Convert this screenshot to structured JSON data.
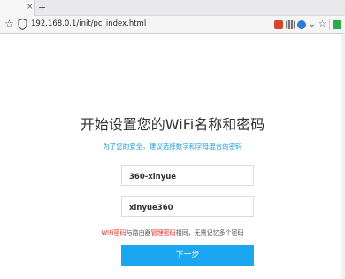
{
  "browser": {
    "tab_close": "×",
    "new_tab": "+",
    "url": "192.168.0.1/init/pc_index.html",
    "icons": [
      "star-icon",
      "shield-icon",
      "lock-shield-icon",
      "grid-icon",
      "blue-circle-icon",
      "chevron-down-icon",
      "star-icon",
      "green-square-icon"
    ]
  },
  "page": {
    "heading": "开始设置您的WiFi名称和密码",
    "subtitle": "为了您的安全，建议选择数字和字母混合的密码",
    "wifi_name": "360-xinyue",
    "wifi_password": "xinyue360",
    "note_part1": "WiFi密码",
    "note_part2": "与路由器",
    "note_part3": "管理密码",
    "note_part4": "相同，无需记忆多个密码",
    "next_label": "下一步"
  },
  "colors": {
    "accent": "#1ba6f1",
    "subtitle": "#1a9fe0",
    "warning": "#e6312a"
  }
}
